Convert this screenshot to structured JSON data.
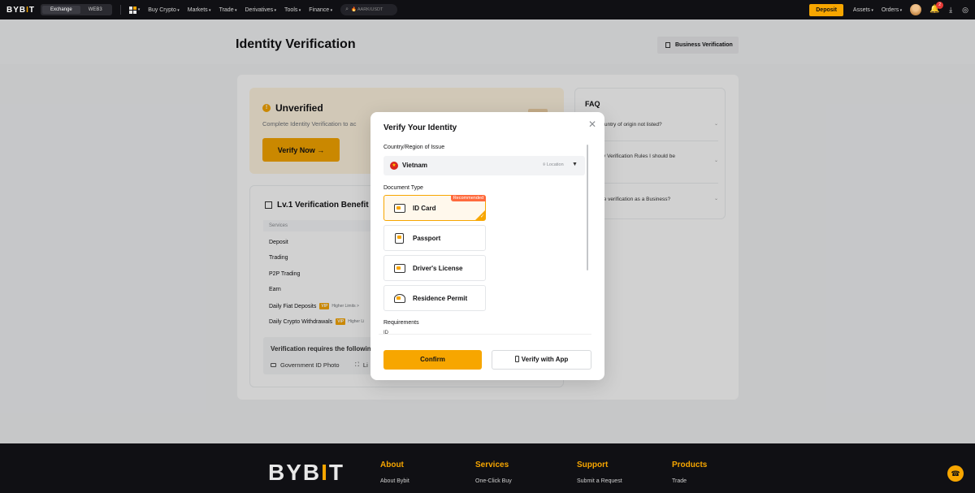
{
  "topnav": {
    "logo": "BYBIT",
    "switch": [
      "Exchange",
      "WEB3"
    ],
    "menu": [
      "Buy Crypto",
      "Markets",
      "Trade",
      "Derivatives",
      "Tools",
      "Finance"
    ],
    "search_placeholder": "AARK/USDT",
    "deposit_label": "Deposit",
    "right_menu": [
      "Assets",
      "Orders"
    ],
    "notification_count": "2"
  },
  "page": {
    "title": "Identity Verification",
    "business_button": "Business Verification"
  },
  "unverified": {
    "status": "Unverified",
    "subtitle": "Complete Identity Verification to ac",
    "cta": "Verify Now →"
  },
  "benefits": {
    "title": "Lv.1 Verification Benefit",
    "column_header": "Services",
    "rows": [
      "Deposit",
      "Trading",
      "P2P Trading",
      "Earn",
      "Daily Fiat Deposits",
      "Daily Crypto Withdrawals"
    ],
    "vip_tag": "VIP",
    "higher_limits": "Higher Limits >",
    "higher_limits_short": "Higher Li",
    "requires_title": "Verification requires the followin",
    "requires_items": [
      "Government ID Photo",
      "Li"
    ]
  },
  "faq": {
    "title": "FAQ",
    "items": [
      "is my country of origin not listed?",
      "here any Verification Rules I should be",
      "of?",
      "complete verification as a Business?"
    ]
  },
  "modal": {
    "title": "Verify Your Identity",
    "country_label": "Country/Region of Issue",
    "country_value": "Vietnam",
    "location_tag": "Location",
    "doc_type_label": "Document Type",
    "doc_options": [
      "ID Card",
      "Passport",
      "Driver's License",
      "Residence Permit"
    ],
    "recommended": "Recommended",
    "requirements_label": "Requirements",
    "requirements_cut": "ID",
    "confirm": "Confirm",
    "verify_app": "Verify with App"
  },
  "footer": {
    "logo": "BYBIT",
    "columns": [
      {
        "head": "About",
        "link": "About Bybit"
      },
      {
        "head": "Services",
        "link": "One-Click Buy"
      },
      {
        "head": "Support",
        "link": "Submit a Request"
      },
      {
        "head": "Products",
        "link": "Trade"
      }
    ]
  },
  "colors": {
    "accent": "#f7a600",
    "nav_bg": "#101014",
    "recommended": "#ff6a3d"
  }
}
